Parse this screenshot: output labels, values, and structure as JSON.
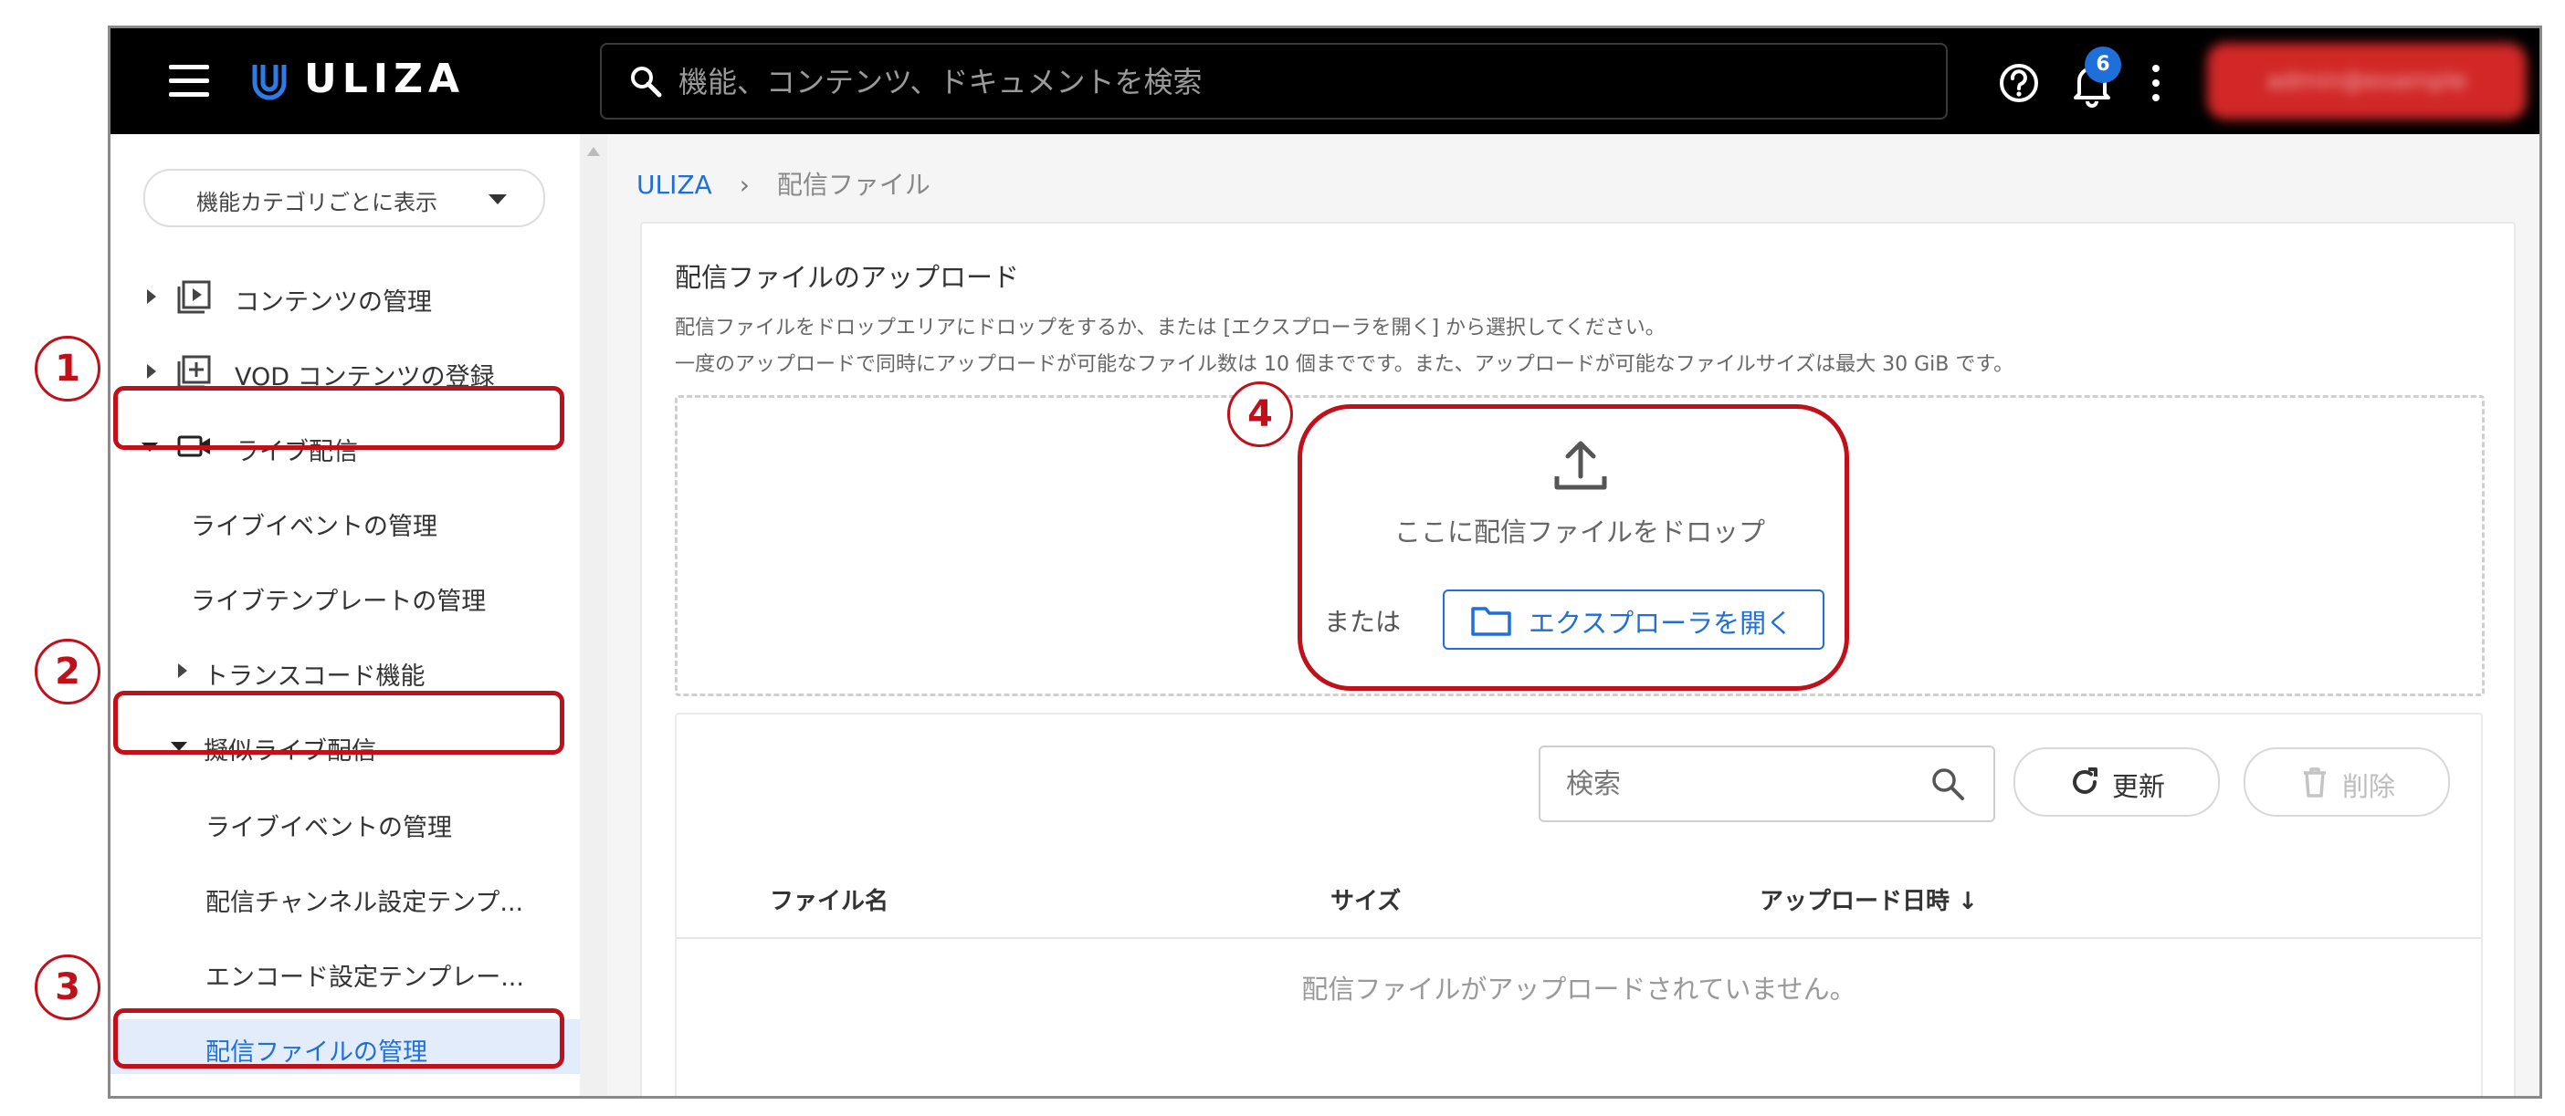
{
  "header": {
    "logo_text": "ULIZA",
    "search_placeholder": "機能、コンテンツ、ドキュメントを検索",
    "notification_count": "6",
    "account_label": "admin@example"
  },
  "sidebar": {
    "category_button": "機能カテゴリごとに表示",
    "items": [
      {
        "label": "コンテンツの管理"
      },
      {
        "label": "VOD コンテンツの登録"
      },
      {
        "label": "ライブ配信"
      },
      {
        "label": "ライブイベントの管理"
      },
      {
        "label": "ライブテンプレートの管理"
      },
      {
        "label": "トランスコード機能"
      },
      {
        "label": "擬似ライブ配信"
      },
      {
        "label": "ライブイベントの管理"
      },
      {
        "label": "配信チャンネル設定テンプ..."
      },
      {
        "label": "エンコード設定テンプレー..."
      },
      {
        "label": "配信ファイルの管理"
      }
    ]
  },
  "annotations": [
    "1",
    "2",
    "3",
    "4"
  ],
  "breadcrumb": {
    "home": "ULIZA",
    "sep": "›",
    "current": "配信ファイル"
  },
  "upload": {
    "title": "配信ファイルのアップロード",
    "desc1": "配信ファイルをドロップエリアにドロップをするか、または [エクスプローラを開く] から選択してください。",
    "desc2": "一度のアップロードで同時にアップロードが可能なファイル数は 10 個までです。また、アップロードが可能なファイルサイズは最大 30 GiB です。",
    "drop_label": "ここに配信ファイルをドロップ",
    "or_label": "または",
    "explorer_button": "エクスプローラを開く"
  },
  "file_list": {
    "search_placeholder": "検索",
    "refresh_button": "更新",
    "delete_button": "削除",
    "columns": [
      "ファイル名",
      "サイズ",
      "アップロード日時"
    ],
    "sort_indicator": "↓",
    "empty_message": "配信ファイルがアップロードされていません。"
  },
  "colors": {
    "accent": "#1e6fd9",
    "annotation_red": "#c0101a",
    "topbar": "#000000",
    "active_bg": "#e3ecfa"
  }
}
